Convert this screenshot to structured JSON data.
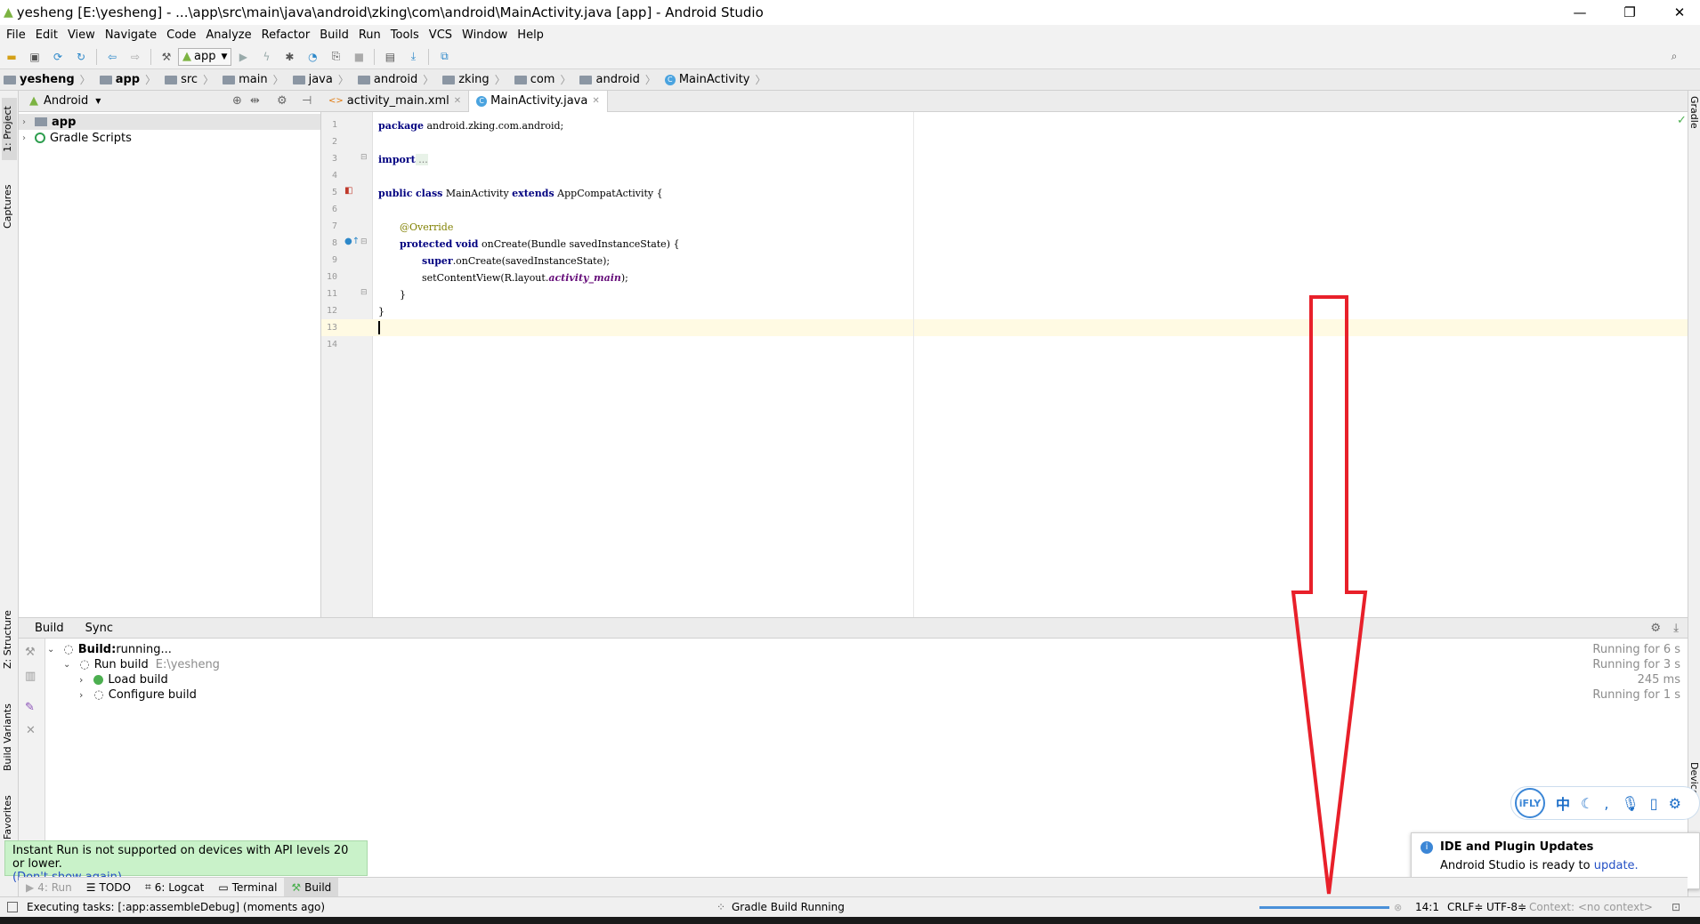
{
  "window": {
    "title": "yesheng [E:\\yesheng] - ...\\app\\src\\main\\java\\android\\zking\\com\\android\\MainActivity.java [app] - Android Studio",
    "minimize": "—",
    "maximize": "❐",
    "close": "✕"
  },
  "menu": [
    "File",
    "Edit",
    "View",
    "Navigate",
    "Code",
    "Analyze",
    "Refactor",
    "Build",
    "Run",
    "Tools",
    "VCS",
    "Window",
    "Help"
  ],
  "toolbar": {
    "run_config": "app"
  },
  "breadcrumb": [
    "yesheng",
    "app",
    "src",
    "main",
    "java",
    "android",
    "zking",
    "com",
    "android",
    "MainActivity"
  ],
  "project_panel": {
    "view_mode": "Android",
    "tree": [
      {
        "label": "app",
        "bold": true
      },
      {
        "label": "Gradle Scripts",
        "bold": false
      }
    ]
  },
  "left_tabs": {
    "project": "1: Project",
    "captures": "Captures",
    "structure": "Z: Structure",
    "build_variants": "Build Variants",
    "favorites": "Favorites"
  },
  "right_tabs": {
    "gradle": "Gradle",
    "device": "Device"
  },
  "editor": {
    "tabs": [
      {
        "label": "activity_main.xml",
        "active": false
      },
      {
        "label": "MainActivity.java",
        "active": true
      }
    ],
    "line_numbers": [
      "1",
      "2",
      "3",
      "4",
      "5",
      "6",
      "7",
      "8",
      "9",
      "10",
      "11",
      "12",
      "13",
      "14"
    ],
    "code": {
      "l1_kw": "package",
      "l1_rest": " android.zking.com.android;",
      "l3_kw": "import",
      "l3_fold": " ...",
      "l6_kw1": "public",
      "l6_kw2": "class",
      "l6_name": " MainActivity ",
      "l6_kw3": "extends",
      "l6_rest": " AppCompatActivity {",
      "l8_ann": "@Override",
      "l9_kw1": "protected",
      "l9_kw2": "void",
      "l9_rest": " onCreate(Bundle savedInstanceState) {",
      "l10_kw": "super",
      "l10_rest": ".onCreate(savedInstanceState);",
      "l11_pre": "setContentView(R.layout.",
      "l11_fld": "activity_main",
      "l11_post": ");",
      "l12": "}",
      "l13": "}"
    }
  },
  "build_panel": {
    "tabs": [
      "Build",
      "Sync"
    ],
    "rows": [
      {
        "bold": "Build:",
        "text": " running...",
        "time": "Running for 6 s"
      },
      {
        "text": "Run build",
        "sub": "E:\\yesheng",
        "time": "Running for 3 s"
      },
      {
        "text": "Load build",
        "time": "245 ms"
      },
      {
        "text": "Configure build",
        "time": "Running for 1 s"
      }
    ]
  },
  "bottom_tabs": [
    {
      "label": "4: Run",
      "active": false
    },
    {
      "label": "TODO",
      "active": false
    },
    {
      "label": "6: Logcat",
      "active": false
    },
    {
      "label": "Terminal",
      "active": false
    },
    {
      "label": "Build",
      "active": true
    }
  ],
  "status": {
    "message": "Executing tasks: [:app:assembleDebug] (moments ago)",
    "gradle": "Gradle Build Running",
    "position": "14:1",
    "line_sep": "CRLF≑",
    "encoding": "UTF-8≑",
    "context": "Context: <no context>"
  },
  "instant_run": {
    "text": "Instant Run is not supported on devices with API levels 20 or lower.",
    "link": "(Don't show again)"
  },
  "updates": {
    "title": "IDE and Plugin Updates",
    "text": "Android Studio is ready to ",
    "link": "update."
  },
  "ifly": {
    "logo": "iFLY",
    "chinese": "中"
  },
  "colors": {
    "arrow": "#e8202a",
    "highlight_line": "#fffae3",
    "progress": "#4a90d9"
  }
}
